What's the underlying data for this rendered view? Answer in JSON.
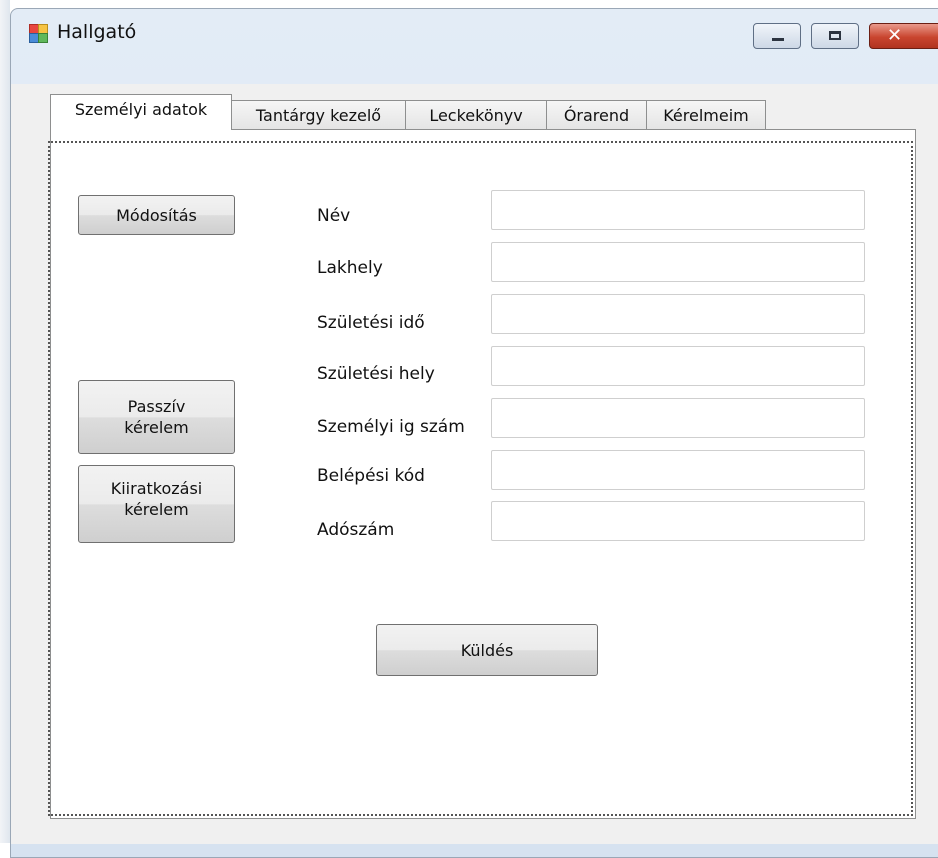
{
  "window": {
    "title": "Hallgató",
    "controls": {
      "minimize": "minimize",
      "maximize": "maximize",
      "close": "close"
    }
  },
  "tabs": [
    {
      "label": "Személyi adatok",
      "active": true
    },
    {
      "label": "Tantárgy kezelő",
      "active": false
    },
    {
      "label": "Leckekönyv",
      "active": false
    },
    {
      "label": "Órarend",
      "active": false
    },
    {
      "label": "Kérelmeim",
      "active": false
    }
  ],
  "buttons": {
    "modify": "Módosítás",
    "passive_line1": "Passzív",
    "passive_line2": "kérelem",
    "withdraw_line1": "Kiiratkozási",
    "withdraw_line2": "kérelem",
    "send": "Küldés"
  },
  "fields": [
    {
      "label": "Név",
      "value": ""
    },
    {
      "label": "Lakhely",
      "value": ""
    },
    {
      "label": "Születési idő",
      "value": ""
    },
    {
      "label": "Születési hely",
      "value": ""
    },
    {
      "label": "Személyi ig szám",
      "value": ""
    },
    {
      "label": "Belépési kód",
      "value": ""
    },
    {
      "label": "Adószám",
      "value": ""
    }
  ]
}
